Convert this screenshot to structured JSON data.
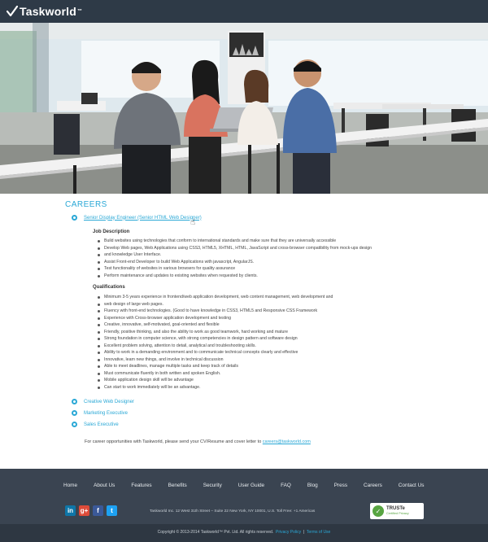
{
  "header": {
    "logo_text": "Taskworld",
    "logo_tm": "™"
  },
  "careers": {
    "title": "CAREERS",
    "jobs": [
      {
        "title": "Senior Display Engineer (Senior HTML Web Designer)"
      },
      {
        "title": "Creative Web Designer"
      },
      {
        "title": "Marketing Executive"
      },
      {
        "title": "Sales Executive"
      }
    ],
    "job_description_heading": "Job Description",
    "job_description": [
      "Build websites using technologies that conform to international standards and make sure that they are universally accessible",
      "Develop Web pages, Web Applications using CSS3, HTML5, XHTML, HTML, JavaScript and cross-browser compatibility from mock-ups design",
      "and knowledge User Interface.",
      "Assist Front-end Developer to build Web Applications with javascript, AngularJS.",
      "Test functionality of websites in various browsers for quality assurance",
      "Perform maintenance and updates to existing websites when requested by clients."
    ],
    "qualifications_heading": "Qualifications",
    "qualifications": [
      "Minimum 3-5 years experience in frontend/web application development, web content management, web development and",
      "web design of large web pages.",
      "Fluency with front-end technologies. (Good to have knowledge in CSS3, HTML5 and Responsive CSS Framework",
      "Experience with Cross-browser application development and testing",
      "Creative, innovative, self-motivated, goal-oriented and flexible",
      "Friendly, positive thinking, and also the ability to work as good teamwork, hard working and mature",
      "Strong foundation in computer science, with strong competencies in design pattern and software design",
      "Excellent problem solving, attention to detail, analytical and troubleshooting skills.",
      "Ability to work in a demanding environment and to communicate technical concepts clearly and effective",
      "Innovative, learn new things, and involve in technical discussion",
      "Able to meet deadlines, manage multiple tasks and keep track of details",
      "Must communicate fluently in both written and spoken English.",
      "Mobile application design skill will be advantage",
      "Can start to work immediately will be an advantage."
    ],
    "contact_prefix": "For career opportunities with Taskworld, please send your CV/Resume and cover letter to",
    "contact_email": "careers@taskworld.com"
  },
  "footer": {
    "nav": [
      "Home",
      "About Us",
      "Features",
      "Benefits",
      "Security",
      "User Guide",
      "FAQ",
      "Blog",
      "Press",
      "Careers",
      "Contact Us"
    ],
    "social": [
      "in",
      "g+",
      "f",
      "t"
    ],
    "address": "Taskworld Inc. 12 West 31th Street – Suite 22 New York, NY 10001, U.S. Toll Free: +1 Americas",
    "truste_title": "TRUSTe",
    "truste_sub": "Certified Privacy",
    "copyright": "Copyright © 2013-2014 Taskworld™ Pvt. Ltd. All rights reserved.",
    "privacy_label": "Privacy Policy",
    "terms_label": "Terms of Use"
  },
  "colors": {
    "accent": "#2aa8d6",
    "header_bg": "#2e3a47",
    "footer_bg": "#3a4451"
  }
}
